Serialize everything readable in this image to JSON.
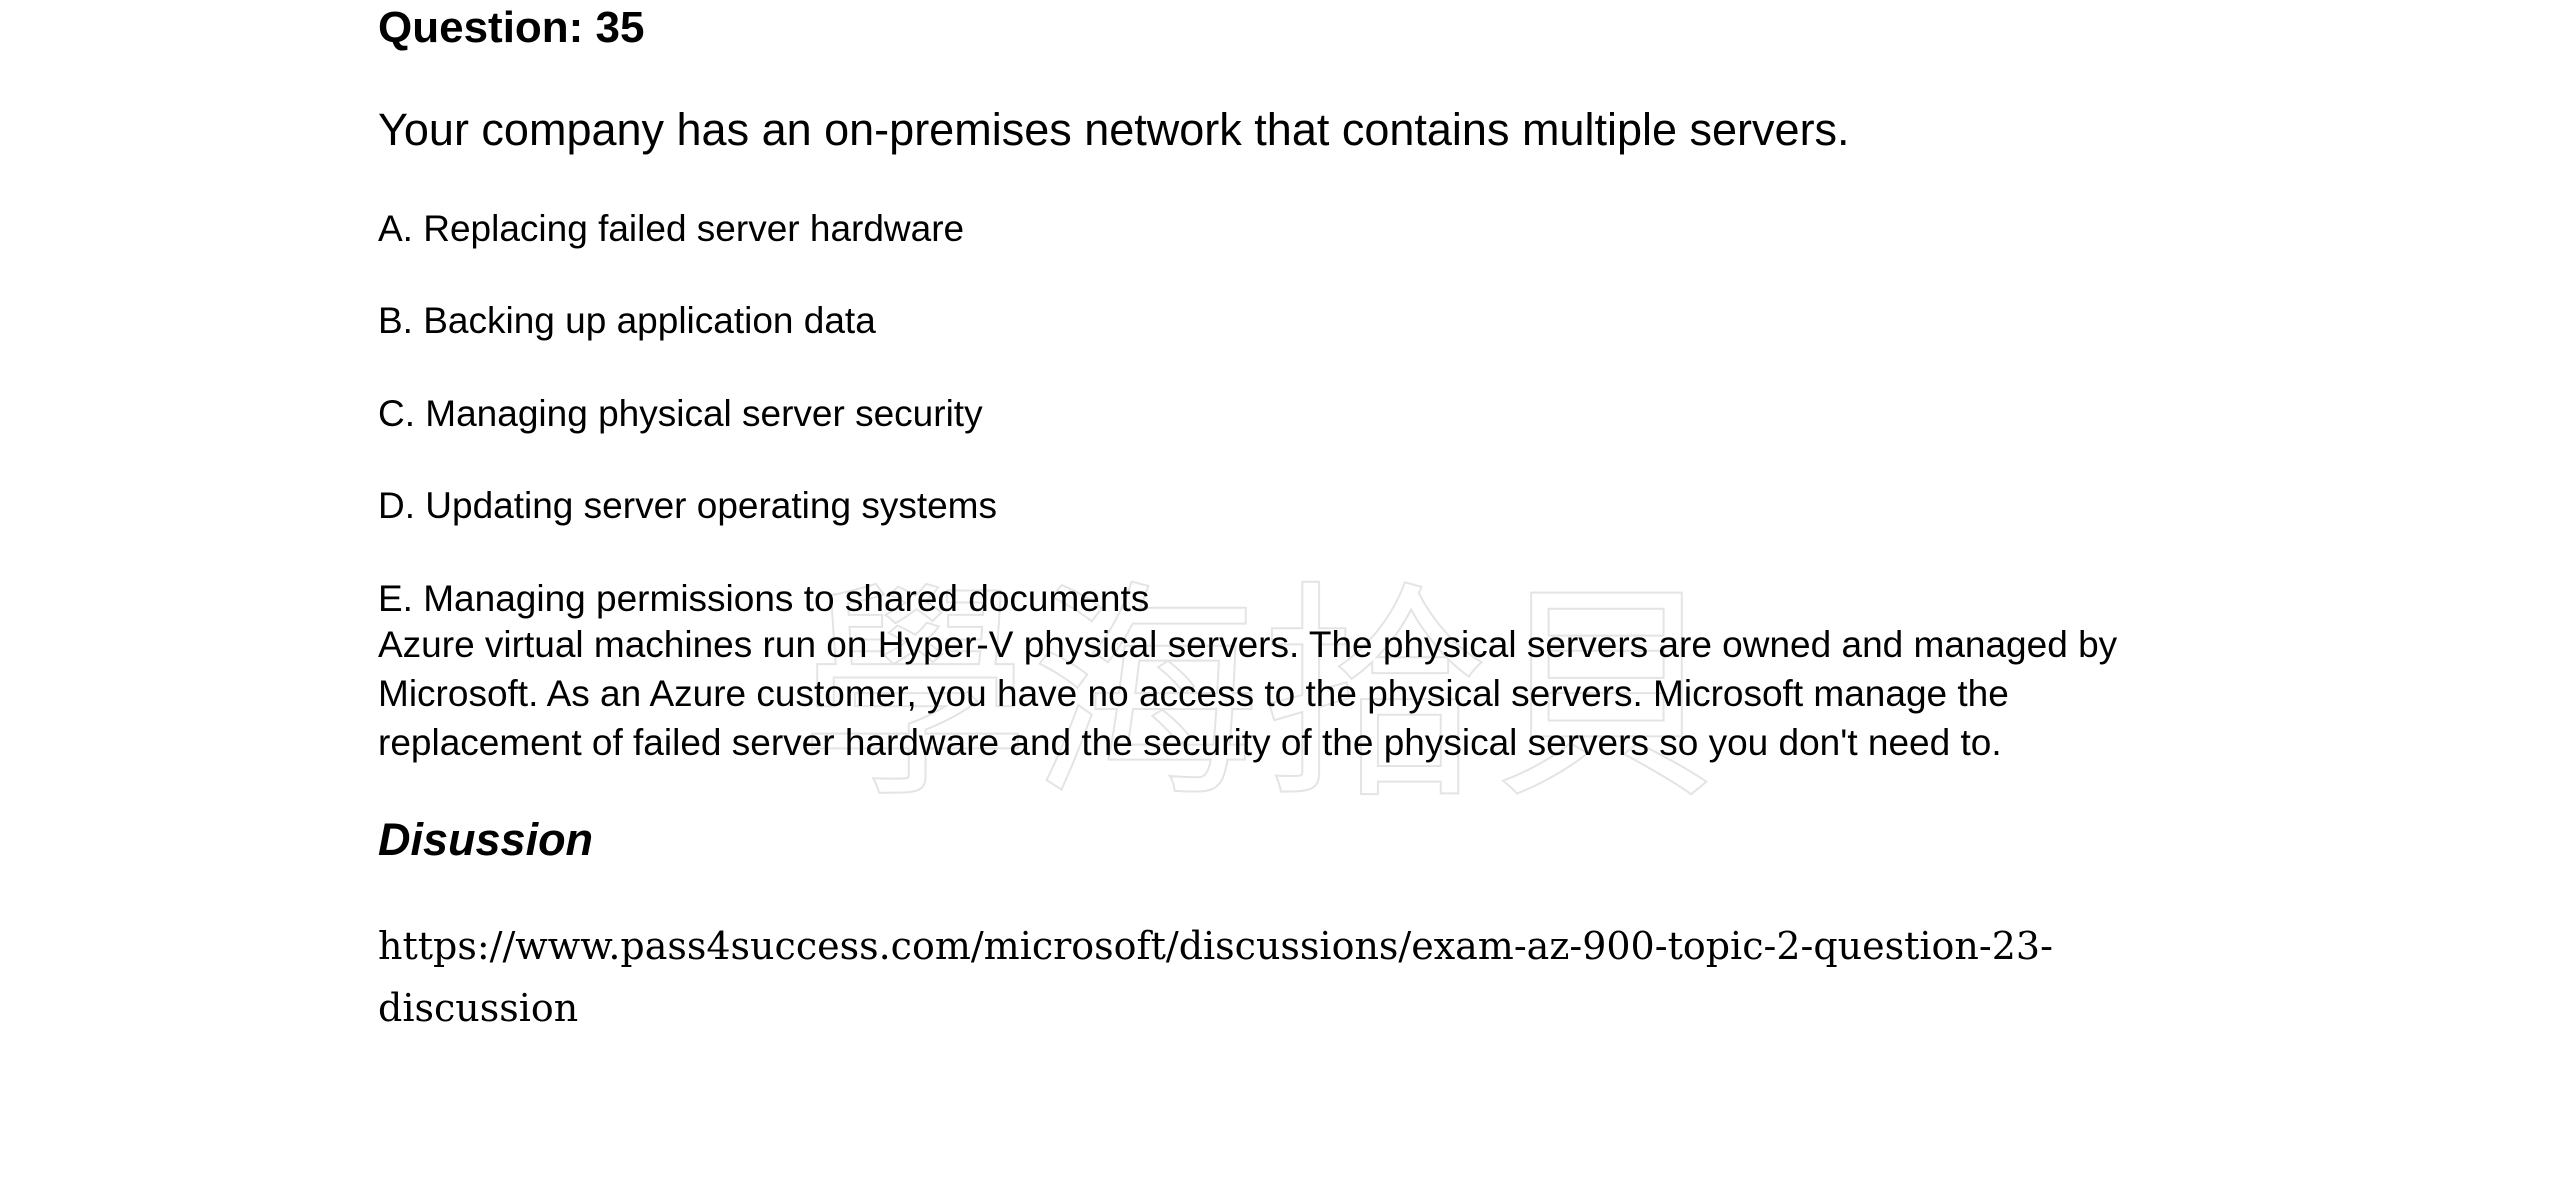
{
  "question": {
    "title": "Question: 35",
    "text": "Your company has an on-premises network that contains multiple servers.",
    "options": [
      {
        "label": "A. Replacing failed server hardware"
      },
      {
        "label": "B. Backing up application data"
      },
      {
        "label": "C. Managing physical server security"
      },
      {
        "label": "D. Updating server operating systems"
      },
      {
        "label": "E. Managing permissions to shared documents"
      }
    ],
    "explanation_lines": [
      "Azure virtual machines run on Hyper-V physical servers. The physical servers are owned and managed by",
      "Microsoft. As an Azure customer, you have no access to the physical servers. Microsoft manage the",
      "replacement of failed server hardware and the security of the physical servers so you don't need to."
    ]
  },
  "discussion": {
    "title": "Disussion",
    "link_lines": [
      "https://www.pass4success.com/microsoft/discussions/exam-az-900-topic-2-question-23-",
      "discussion"
    ]
  },
  "watermark": {
    "text": "學海拾貝",
    "color": "#e4e4e4"
  }
}
